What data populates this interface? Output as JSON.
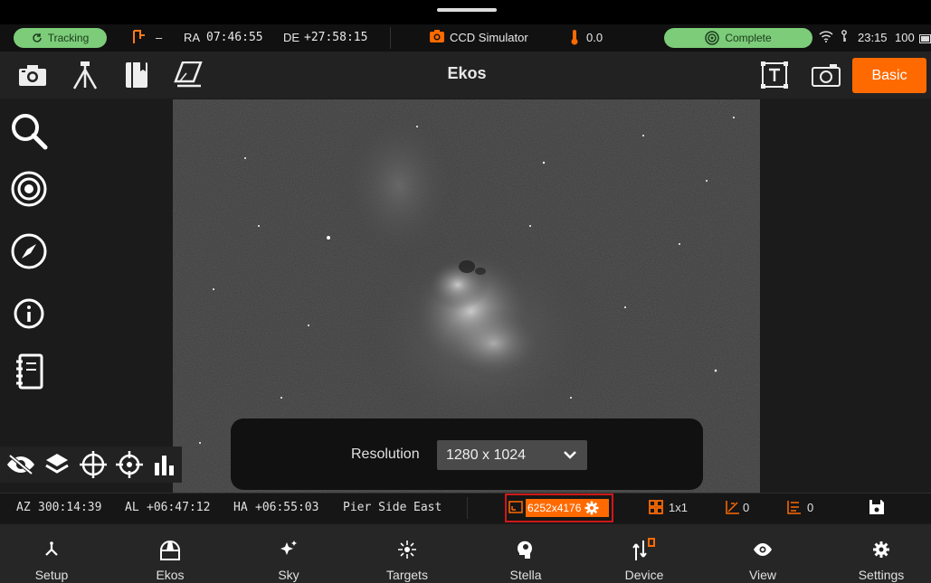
{
  "status": {
    "tracking_label": "Tracking",
    "mount_dash": "–",
    "ra_label": "RA",
    "ra_value": "07:46:55",
    "de_label": "DE",
    "de_value": "+27:58:15",
    "camera_name": "CCD Simulator",
    "temperature": "0.0",
    "complete_label": "Complete",
    "time": "23:15",
    "battery": "100"
  },
  "toolbar": {
    "title": "Ekos",
    "basic_label": "Basic"
  },
  "resolution_popup": {
    "label": "Resolution",
    "value": "1280 x 1024"
  },
  "info_bar": {
    "az_label": "AZ",
    "az_value": "300:14:39",
    "al_label": "AL",
    "al_value": "+06:47:12",
    "ha_label": "HA",
    "ha_value": "+06:55:03",
    "pier_label": "Pier Side",
    "pier_value": "East",
    "resolution": "6252x4176",
    "binning": "1x1",
    "gain": "0",
    "offset": "0"
  },
  "nav": [
    {
      "label": "Setup",
      "icon": "setup-icon"
    },
    {
      "label": "Ekos",
      "icon": "ekos-icon"
    },
    {
      "label": "Sky",
      "icon": "sky-icon"
    },
    {
      "label": "Targets",
      "icon": "targets-icon"
    },
    {
      "label": "Stella",
      "icon": "stella-icon"
    },
    {
      "label": "Device",
      "icon": "device-icon"
    },
    {
      "label": "View",
      "icon": "view-icon"
    },
    {
      "label": "Settings",
      "icon": "settings-icon"
    }
  ],
  "colors": {
    "accent": "#ff6a00",
    "status_green": "#7ccc79",
    "highlight_border": "#d01818"
  }
}
